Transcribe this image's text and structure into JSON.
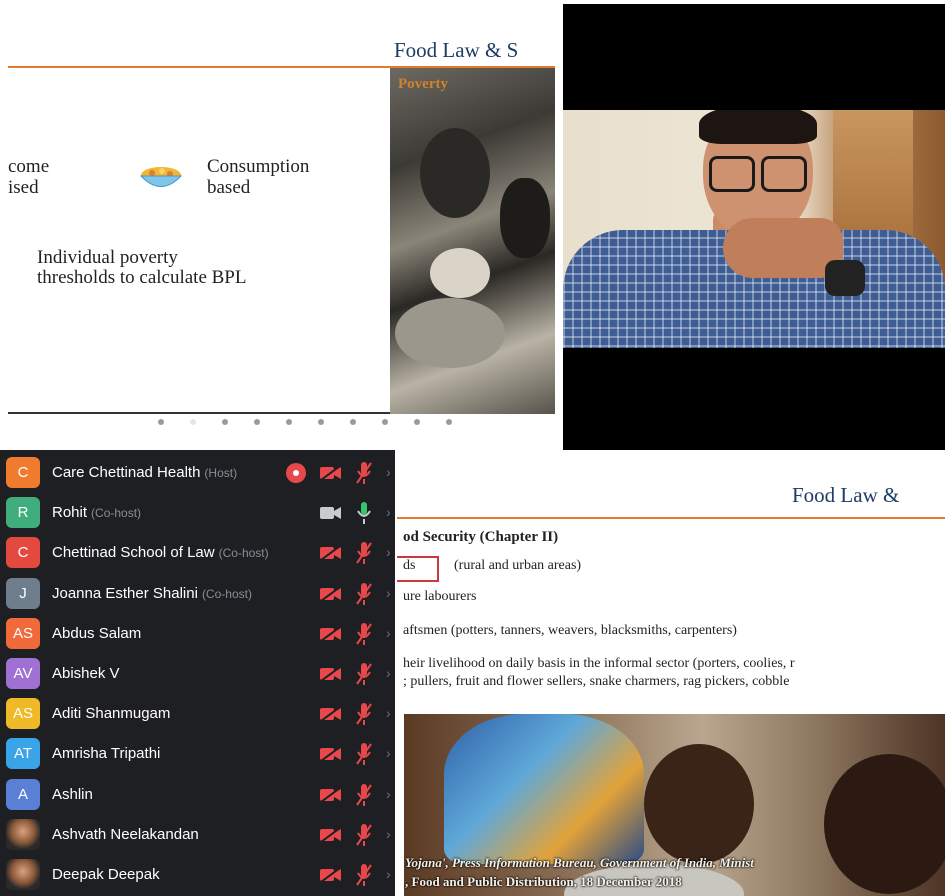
{
  "slide_top": {
    "title": "Food Law & S",
    "photo_caption": "Poverty",
    "income_line1": "come",
    "income_line2": "ised",
    "consumption_line1": "Consumption",
    "consumption_line2": "based",
    "bpl_line1": "Individual poverty",
    "bpl_line2": "thresholds to calculate BPL",
    "dots_total": 10,
    "dot_active_index": 1
  },
  "video": {
    "speaker": "bespectacled man in checked shirt, hand on chin"
  },
  "participants": [
    {
      "initials": "C",
      "color": "#f07a2e",
      "name": "Care Chettinad Health",
      "role": "(Host)",
      "recording": true,
      "video_on": false,
      "mic_on": false
    },
    {
      "initials": "R",
      "color": "#3fae7c",
      "name": "Rohit",
      "role": "(Co-host)",
      "recording": false,
      "video_on": true,
      "mic_on": true
    },
    {
      "initials": "C",
      "color": "#e4493f",
      "name": "Chettinad School of Law",
      "role": "(Co-host)",
      "recording": false,
      "video_on": false,
      "mic_on": false
    },
    {
      "initials": "J",
      "color": "#6f7e8c",
      "name": "Joanna Esther Shalini",
      "role": "(Co-host)",
      "recording": false,
      "video_on": false,
      "mic_on": false
    },
    {
      "initials": "AS",
      "color": "#f06a3c",
      "name": "Abdus Salam",
      "role": "",
      "recording": false,
      "video_on": false,
      "mic_on": false
    },
    {
      "initials": "AV",
      "color": "#a071d3",
      "name": "Abishek V",
      "role": "",
      "recording": false,
      "video_on": false,
      "mic_on": false
    },
    {
      "initials": "AS",
      "color": "#f0b928",
      "name": "Aditi Shanmugam",
      "role": "",
      "recording": false,
      "video_on": false,
      "mic_on": false
    },
    {
      "initials": "AT",
      "color": "#3aa4e8",
      "name": "Amrisha Tripathi",
      "role": "",
      "recording": false,
      "video_on": false,
      "mic_on": false
    },
    {
      "initials": "A",
      "color": "#5a7fd6",
      "name": "Ashlin",
      "role": "",
      "recording": false,
      "video_on": false,
      "mic_on": false
    },
    {
      "initials": "",
      "color": "#8c5a3a",
      "name": "Ashvath Neelakandan",
      "role": "",
      "recording": false,
      "video_on": false,
      "mic_on": false,
      "photo": true
    },
    {
      "initials": "",
      "color": "#8c5a3a",
      "name": "Deepak Deepak",
      "role": "",
      "recording": false,
      "video_on": false,
      "mic_on": false,
      "photo": true
    }
  ],
  "slide_bottom": {
    "title": "Food Law &",
    "heading": "od Security (Chapter II)",
    "boxed_word": "ds",
    "line1_rest": "(rural and urban areas)",
    "line2": "ure labourers",
    "line3": "aftsmen (potters, tanners, weavers, blacksmiths, carpenters)",
    "line4": "heir livelihood on daily basis in the informal sector (porters, coolies, r",
    "line5": "; pullers, fruit and flower sellers, snake charmers, rag pickers, cobble",
    "caption1": "Yojana', Press Information Bureau, Government of India, Minist",
    "caption2": ", Food and Public Distribution, 18 December 2018"
  }
}
